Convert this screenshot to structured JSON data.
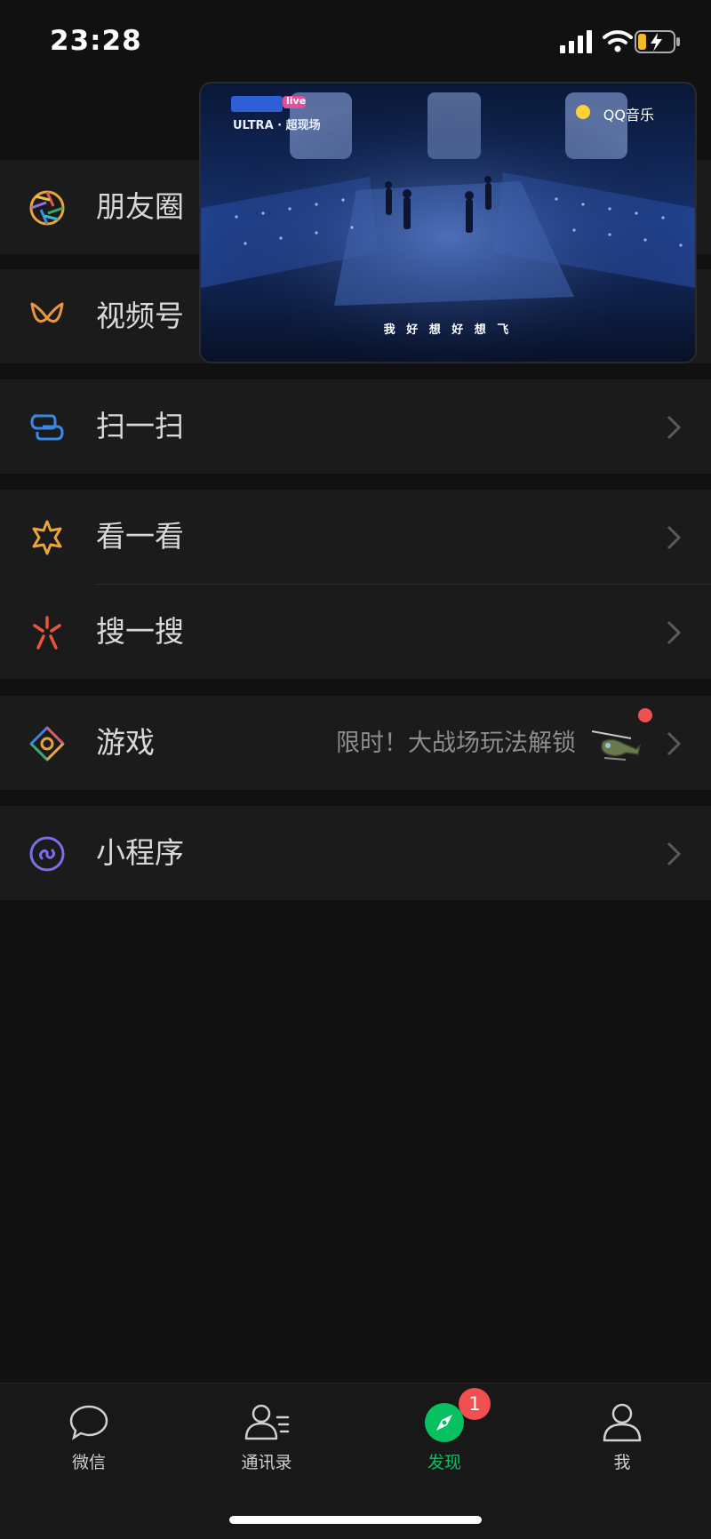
{
  "status_bar": {
    "time": "23:28"
  },
  "menu": {
    "moments": {
      "label": "朋友圈",
      "icon": "moments-icon"
    },
    "channels": {
      "label": "视频号",
      "icon": "channels-icon"
    },
    "scan": {
      "label": "扫一扫",
      "icon": "scan-icon"
    },
    "top_stories": {
      "label": "看一看",
      "icon": "top-stories-icon"
    },
    "search": {
      "label": "搜一搜",
      "icon": "search-icon"
    },
    "games": {
      "label": "游戏",
      "icon": "games-icon",
      "promo": "限时！大战场玩法解锁"
    },
    "mini_programs": {
      "label": "小程序",
      "icon": "mini-programs-icon"
    }
  },
  "video_overlay": {
    "brand": "ULTRA · 超现场",
    "brand_tag": "live",
    "partner": "QQ音乐",
    "subtitle": "我 好 想 好 想 飞"
  },
  "tabbar": {
    "chats": {
      "label": "微信"
    },
    "contacts": {
      "label": "通讯录"
    },
    "discover": {
      "label": "发现",
      "badge": "1"
    },
    "me": {
      "label": "我"
    }
  },
  "colors": {
    "accent": "#07c160",
    "badge": "#f25050",
    "background": "#111111",
    "cell": "#1b1b1b"
  }
}
